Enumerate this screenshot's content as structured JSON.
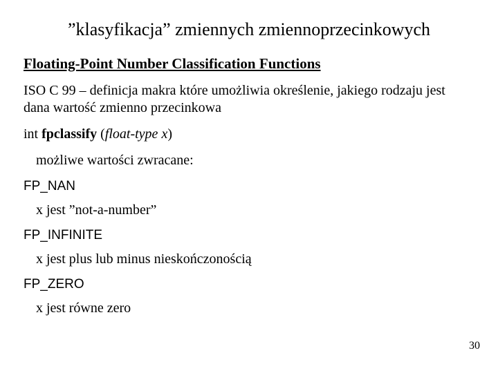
{
  "title": "”klasyfikacja” zmiennych zmiennoprzecinkowych",
  "subheading": "Floating-Point Number Classification Functions",
  "intro": "ISO C 99 – definicja makra które umożliwia określenie, jakiego rodzaju jest dana wartość zmienno przecinkowa",
  "signature": {
    "ret": "int ",
    "name": "fpclassify",
    "open": " (",
    "arg": "float-type x",
    "close": ")"
  },
  "returns_label": "możliwe wartości zwracane:",
  "items": [
    {
      "code": "FP_NAN",
      "desc": "x jest  ”not-a-number”"
    },
    {
      "code": "FP_INFINITE",
      "desc": "x jest plus lub minus nieskończonością"
    },
    {
      "code": "FP_ZERO",
      "desc": "x jest równe zero"
    }
  ],
  "page_number": "30"
}
